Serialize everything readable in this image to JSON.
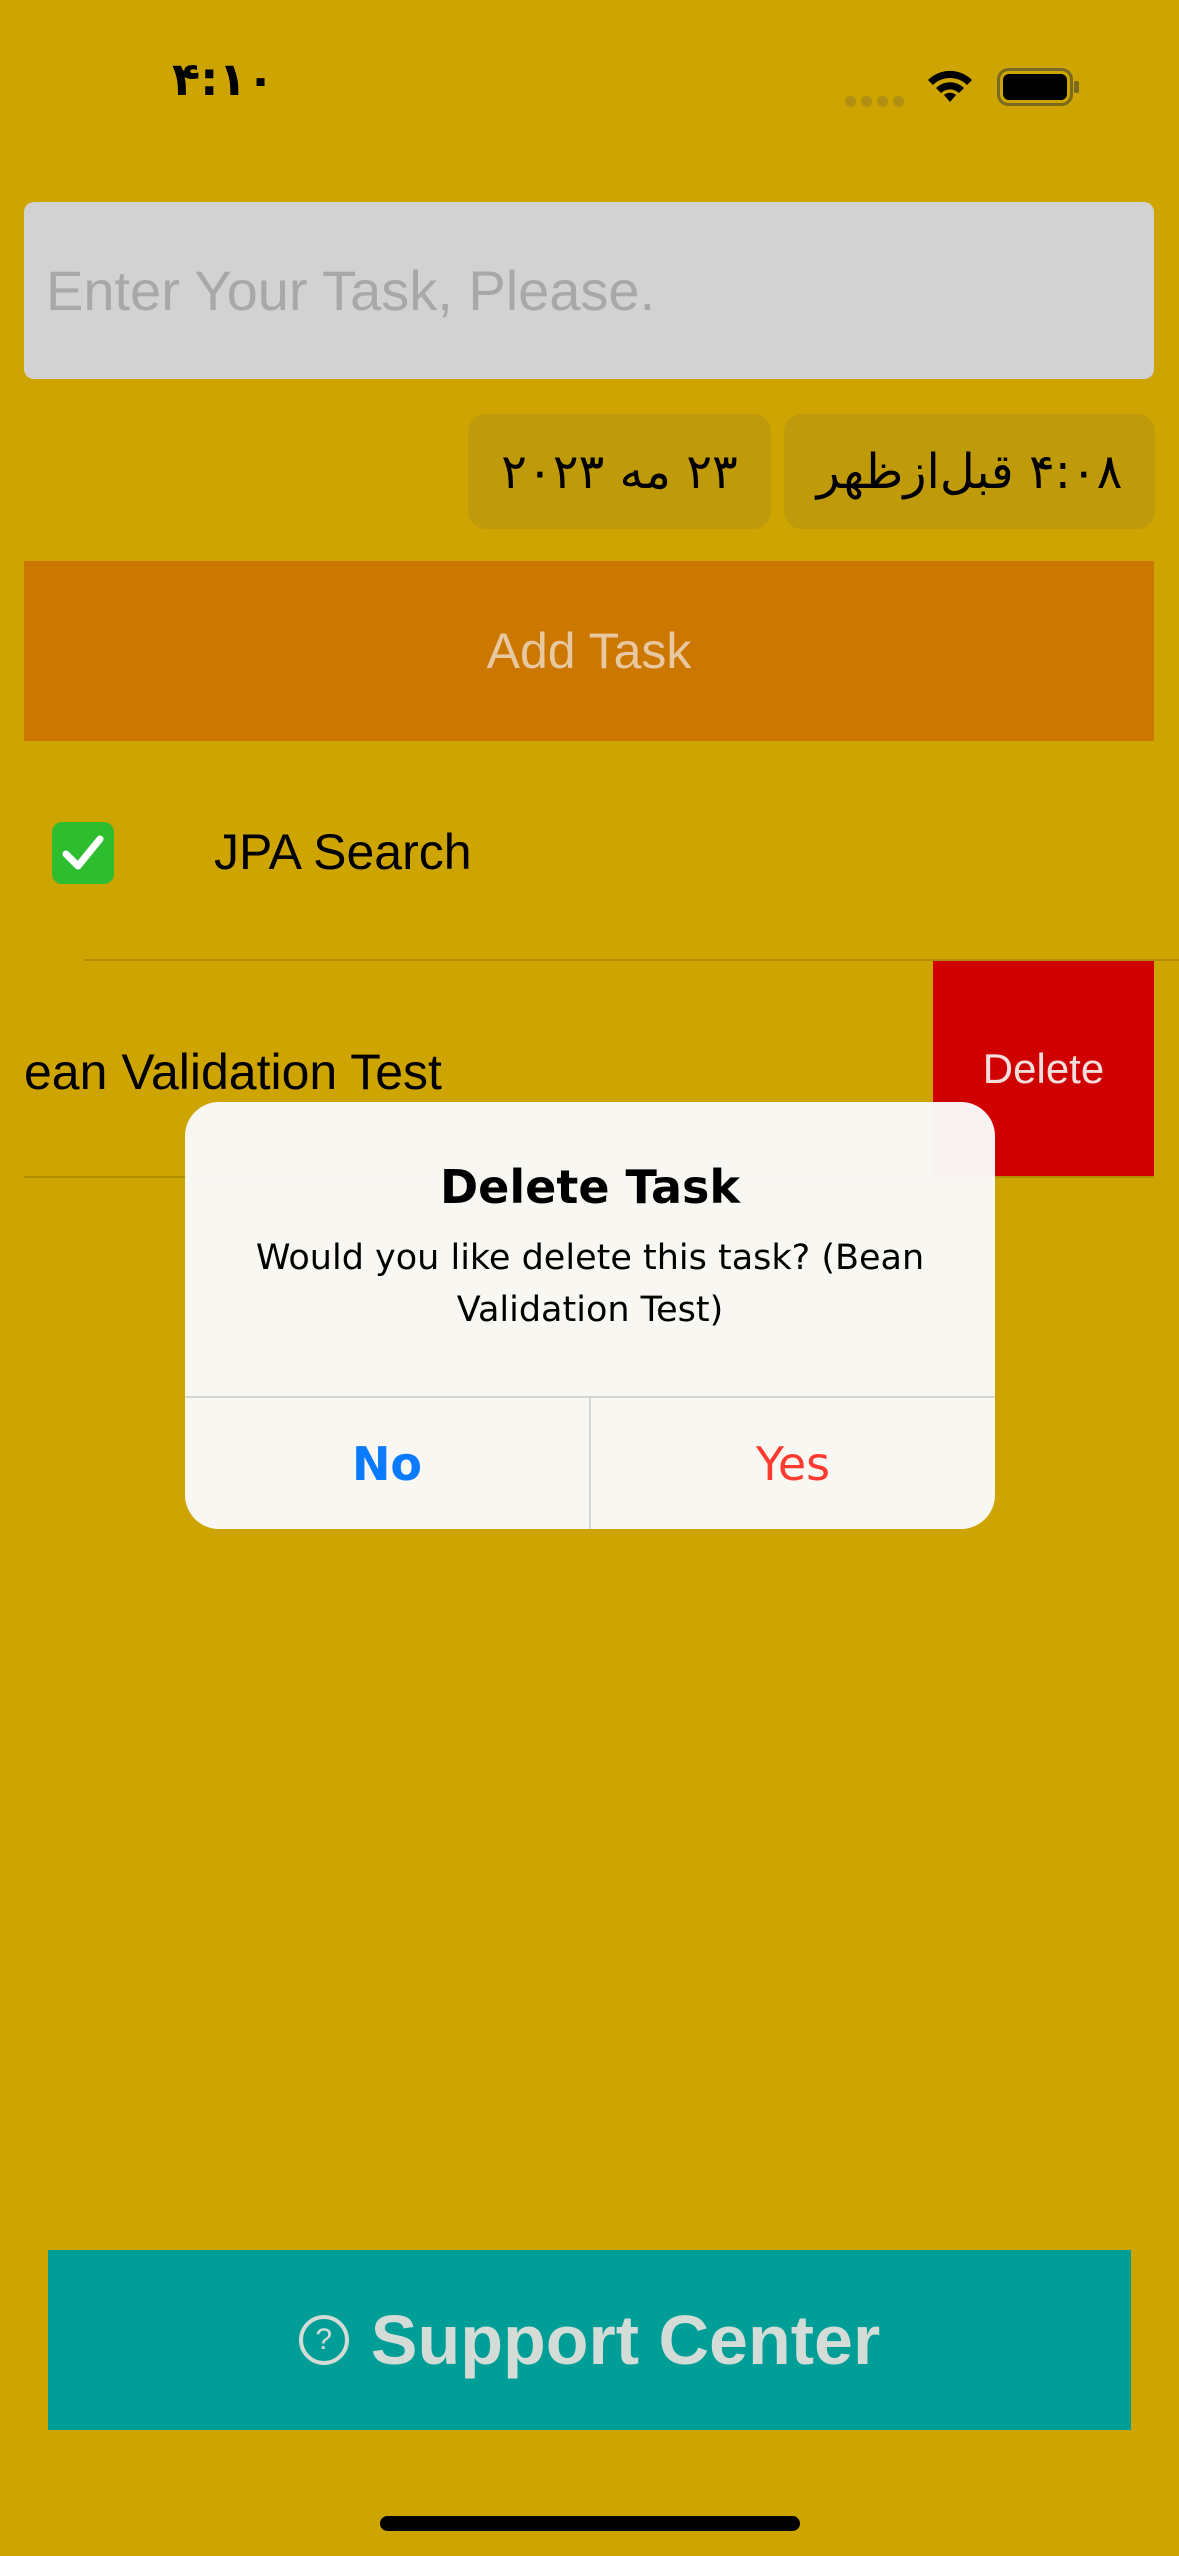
{
  "status_bar": {
    "time": "۴:۱۰",
    "icons": [
      "signal-dots-icon",
      "wifi-icon",
      "battery-icon"
    ]
  },
  "task_input": {
    "placeholder": "Enter Your Task, Please.",
    "value": ""
  },
  "date_picker": {
    "date": "۲۳ مه ۲۰۲۳",
    "time": "۴:۰۸ قبل‌ازظهر"
  },
  "add_task_button": {
    "label": "Add Task"
  },
  "tasks": [
    {
      "label": "JPA Search",
      "done": true,
      "icon": "checkmark-icon"
    },
    {
      "label": "ean Validation Test",
      "done": false,
      "swipe_action": "Delete"
    }
  ],
  "alert": {
    "title": "Delete Task",
    "message": "Would you like delete this task? (Bean Validation Test)",
    "buttons": {
      "no": "No",
      "yes": "Yes"
    }
  },
  "support_button": {
    "label": "Support Center",
    "icon": "question-circle-icon"
  },
  "colors": {
    "background": "#cda400",
    "input_bg": "#d2d2d2",
    "add_button": "#cc7800",
    "delete_red": "#d10000",
    "support_teal": "#009e97",
    "alert_no_blue": "#0a7aff",
    "alert_yes_red": "#ff3b30"
  }
}
